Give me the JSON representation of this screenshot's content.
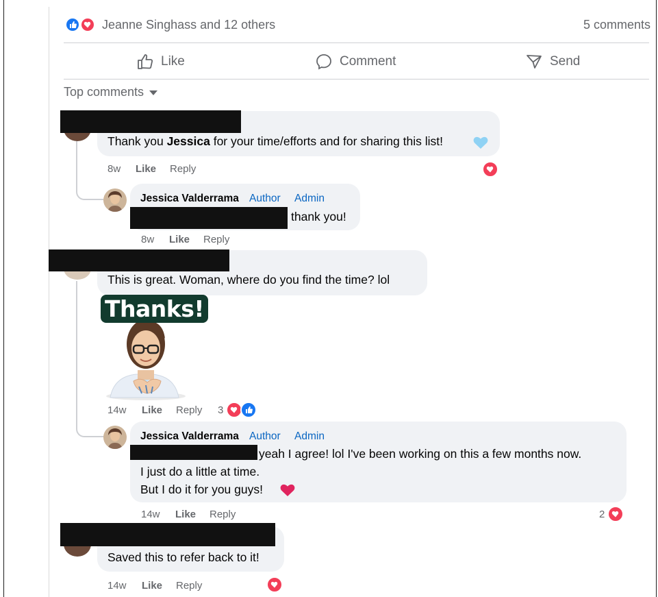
{
  "reactions_bar": {
    "names": "Jeanne Singhass and 12 others",
    "comments_count": "5 comments",
    "icons": [
      "like-icon",
      "love-icon"
    ]
  },
  "actions": {
    "like": "Like",
    "comment": "Comment",
    "send": "Send"
  },
  "sort_label": "Top comments",
  "comments": [
    {
      "text_prefix": "Thank you ",
      "text_bold": "Jessica",
      "text_suffix": " for your time/efforts and for sharing this list!",
      "emoji": "light-blue-heart",
      "time": "8w",
      "like": "Like",
      "reply": "Reply",
      "reply_item": {
        "name": "Jessica Valderrama",
        "badge_author": "Author",
        "badge_admin": "Admin",
        "text": "thank you!",
        "time": "8w",
        "like": "Like",
        "reply": "Reply"
      }
    },
    {
      "text": "This is great. Woman, where do you find the time? lol",
      "sticker_text": "Thanks!",
      "time": "14w",
      "like": "Like",
      "reply": "Reply",
      "reaction_count": "3",
      "reply_item": {
        "name": "Jessica Valderrama",
        "badge_author": "Author",
        "badge_admin": "Admin",
        "line1": "yeah I agree! lol I've been working on this a few months now.",
        "line2": "I just do a little at time.",
        "line3": "But I do it for you guys!",
        "time": "14w",
        "like": "Like",
        "reply": "Reply",
        "reaction_count": "2"
      }
    },
    {
      "text": "Saved this to refer back to it!",
      "time": "14w",
      "like": "Like",
      "reply": "Reply"
    }
  ],
  "colors": {
    "like_blue": "#1877f2",
    "love_red": "#f33e58",
    "badge_blue": "#0a66c2",
    "bubble_gray": "#f0f2f5",
    "meta_gray": "#65676b"
  }
}
